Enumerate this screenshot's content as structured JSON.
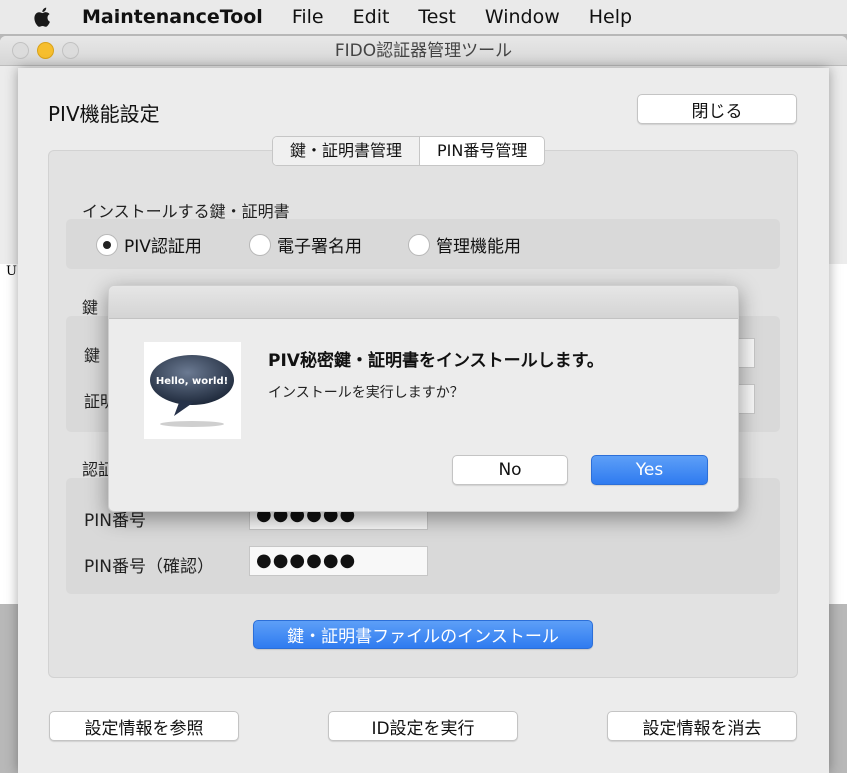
{
  "menubar": {
    "app": "MaintenanceTool",
    "items": [
      "File",
      "Edit",
      "Test",
      "Window",
      "Help"
    ]
  },
  "background_window": {
    "title": "FIDO認証器管理ツール",
    "edge_text": "U"
  },
  "piv_window": {
    "title": "PIV機能設定",
    "close_label": "閉じる",
    "tabs": [
      "鍵・証明書管理",
      "PIN番号管理"
    ],
    "install_section_label": "インストールする鍵・証明書",
    "radios": [
      {
        "label": "PIV認証用",
        "selected": true
      },
      {
        "label": "電子署名用",
        "selected": false
      },
      {
        "label": "管理機能用",
        "selected": false
      }
    ],
    "key_section_label": "鍵",
    "key_row_label": "鍵",
    "cert_row_label": "証明",
    "auth_section_label": "認証",
    "pin_label": "PIN番号",
    "pin_value": "●●●●●●",
    "pin_confirm_label": "PIN番号（確認）",
    "pin_confirm_value": "●●●●●●",
    "install_button": "鍵・証明書ファイルのインストール",
    "footer_buttons": [
      "設定情報を参照",
      "ID設定を実行",
      "設定情報を消去"
    ]
  },
  "dialog": {
    "icon_text": "Hello, world!",
    "message": "PIV秘密鍵・証明書をインストールします。",
    "informative": "インストールを実行しますか？",
    "no_label": "No",
    "yes_label": "Yes"
  },
  "colors": {
    "accent_blue": "#3580f2",
    "traffic_minimize": "#f6be2e"
  }
}
